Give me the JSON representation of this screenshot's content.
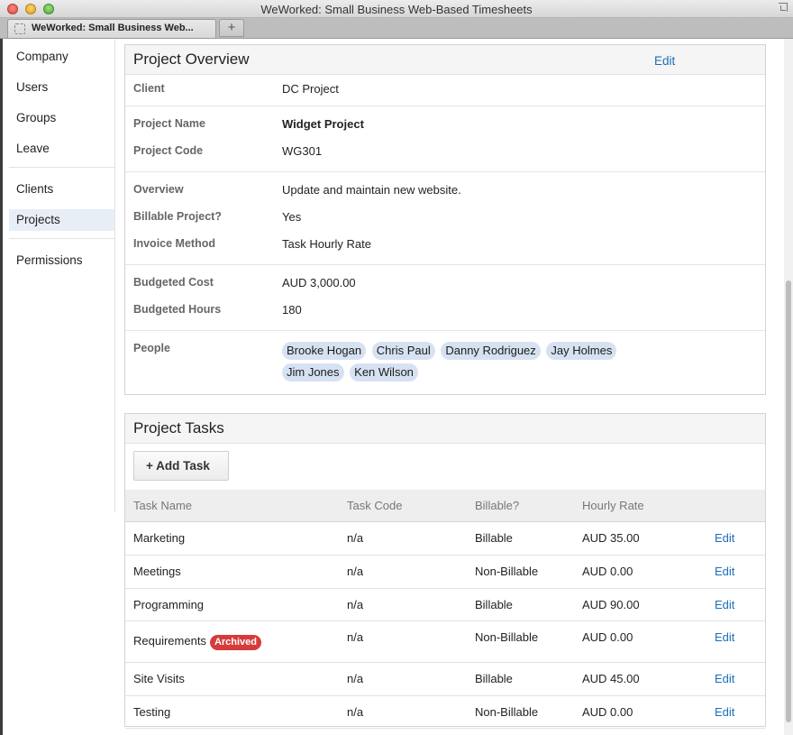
{
  "window": {
    "title": "WeWorked: Small Business Web-Based Timesheets"
  },
  "tab": {
    "title": "WeWorked: Small Business Web...",
    "new_tab": "+"
  },
  "sidebar": {
    "items": [
      {
        "label": "Company"
      },
      {
        "label": "Users"
      },
      {
        "label": "Groups"
      },
      {
        "label": "Leave"
      },
      {
        "label": "Clients"
      },
      {
        "label": "Projects"
      },
      {
        "label": "Permissions"
      }
    ]
  },
  "overview": {
    "title": "Project Overview",
    "edit": "Edit",
    "client": {
      "label": "Client",
      "value": "DC Project"
    },
    "project_name": {
      "label": "Project Name",
      "value": "Widget Project"
    },
    "project_code": {
      "label": "Project Code",
      "value": "WG301"
    },
    "overview": {
      "label": "Overview",
      "value": "Update and maintain new website."
    },
    "billable": {
      "label": "Billable Project?",
      "value": "Yes"
    },
    "invoice": {
      "label": "Invoice Method",
      "value": "Task Hourly Rate"
    },
    "budget_cost": {
      "label": "Budgeted Cost",
      "value": "AUD 3,000.00"
    },
    "budget_hours": {
      "label": "Budgeted Hours",
      "value": "180"
    },
    "people": {
      "label": "People",
      "list": [
        "Brooke Hogan",
        "Chris Paul",
        "Danny Rodriguez",
        "Jay Holmes",
        "Jim Jones",
        "Ken Wilson"
      ]
    }
  },
  "tasks": {
    "title": "Project Tasks",
    "add_label": "+ Add Task",
    "columns": [
      "Task Name",
      "Task Code",
      "Billable?",
      "Hourly Rate"
    ],
    "rows": [
      {
        "name": "Marketing",
        "code": "n/a",
        "billable": "Billable",
        "rate": "AUD 35.00",
        "edit": "Edit",
        "badge": ""
      },
      {
        "name": "Meetings",
        "code": "n/a",
        "billable": "Non-Billable",
        "rate": "AUD 0.00",
        "edit": "Edit",
        "badge": ""
      },
      {
        "name": "Programming",
        "code": "n/a",
        "billable": "Billable",
        "rate": "AUD 90.00",
        "edit": "Edit",
        "badge": ""
      },
      {
        "name": "Requirements",
        "code": "n/a",
        "billable": "Non-Billable",
        "rate": "AUD 0.00",
        "edit": "Edit",
        "badge": "Archived"
      },
      {
        "name": "Site Visits",
        "code": "n/a",
        "billable": "Billable",
        "rate": "AUD 45.00",
        "edit": "Edit",
        "badge": ""
      },
      {
        "name": "Testing",
        "code": "n/a",
        "billable": "Non-Billable",
        "rate": "AUD 0.00",
        "edit": "Edit",
        "badge": ""
      }
    ]
  },
  "colors": {
    "link": "#1a6fb8",
    "chip": "#d6e2f2",
    "archived": "#d63b3b",
    "active_nav": "#e8eef6"
  }
}
